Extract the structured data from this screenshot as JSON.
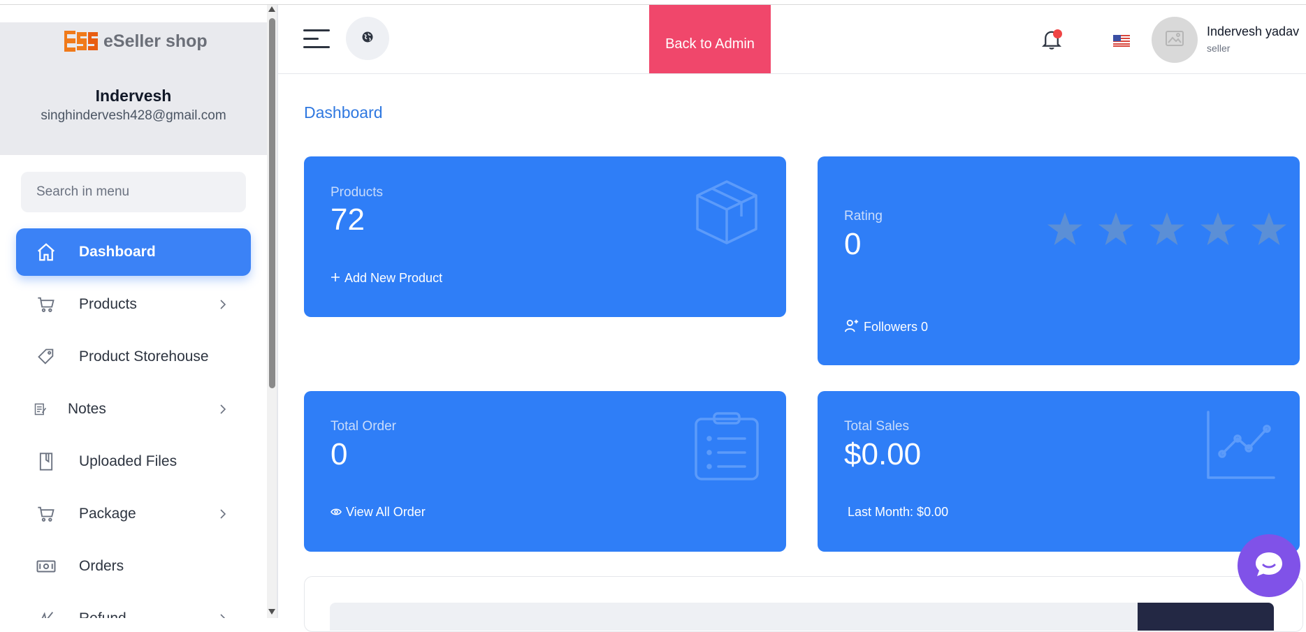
{
  "app": {
    "logo_text": "eSeller shop",
    "logo_mark": "ESS"
  },
  "user": {
    "name": "Indervesh",
    "email": "singhindervesh428@gmail.com"
  },
  "search": {
    "placeholder": "Search in menu"
  },
  "sidebar": {
    "items": [
      {
        "label": "Dashboard",
        "icon": "home-icon",
        "active": true,
        "has_chevron": false
      },
      {
        "label": "Products",
        "icon": "cart-icon",
        "active": false,
        "has_chevron": true
      },
      {
        "label": "Product Storehouse",
        "icon": "tag-icon",
        "active": false,
        "has_chevron": false
      },
      {
        "label": "Notes",
        "icon": "note-icon",
        "active": false,
        "has_chevron": true
      },
      {
        "label": "Uploaded Files",
        "icon": "file-icon",
        "active": false,
        "has_chevron": false
      },
      {
        "label": "Package",
        "icon": "cart-icon",
        "active": false,
        "has_chevron": true
      },
      {
        "label": "Orders",
        "icon": "money-icon",
        "active": false,
        "has_chevron": false
      },
      {
        "label": "Refund",
        "icon": "refund-icon",
        "active": false,
        "has_chevron": true
      }
    ]
  },
  "header": {
    "back_to_admin": "Back to Admin",
    "profile_name": "Indervesh yadav",
    "profile_role": "seller"
  },
  "page": {
    "title": "Dashboard"
  },
  "cards": {
    "products": {
      "label": "Products",
      "value": "72",
      "action": "Add New Product"
    },
    "rating": {
      "label": "Rating",
      "value": "0",
      "followers": "Followers 0",
      "stars": 0
    },
    "orders": {
      "label": "Total Order",
      "value": "0",
      "action": "View All Order"
    },
    "sales": {
      "label": "Total Sales",
      "value": "$0.00",
      "last_month": "Last Month: $0.00"
    }
  },
  "colors": {
    "accent": "#3b82f6",
    "card": "#2f7ef7",
    "back_admin": "#f0476b",
    "chat": "#8052e8"
  }
}
